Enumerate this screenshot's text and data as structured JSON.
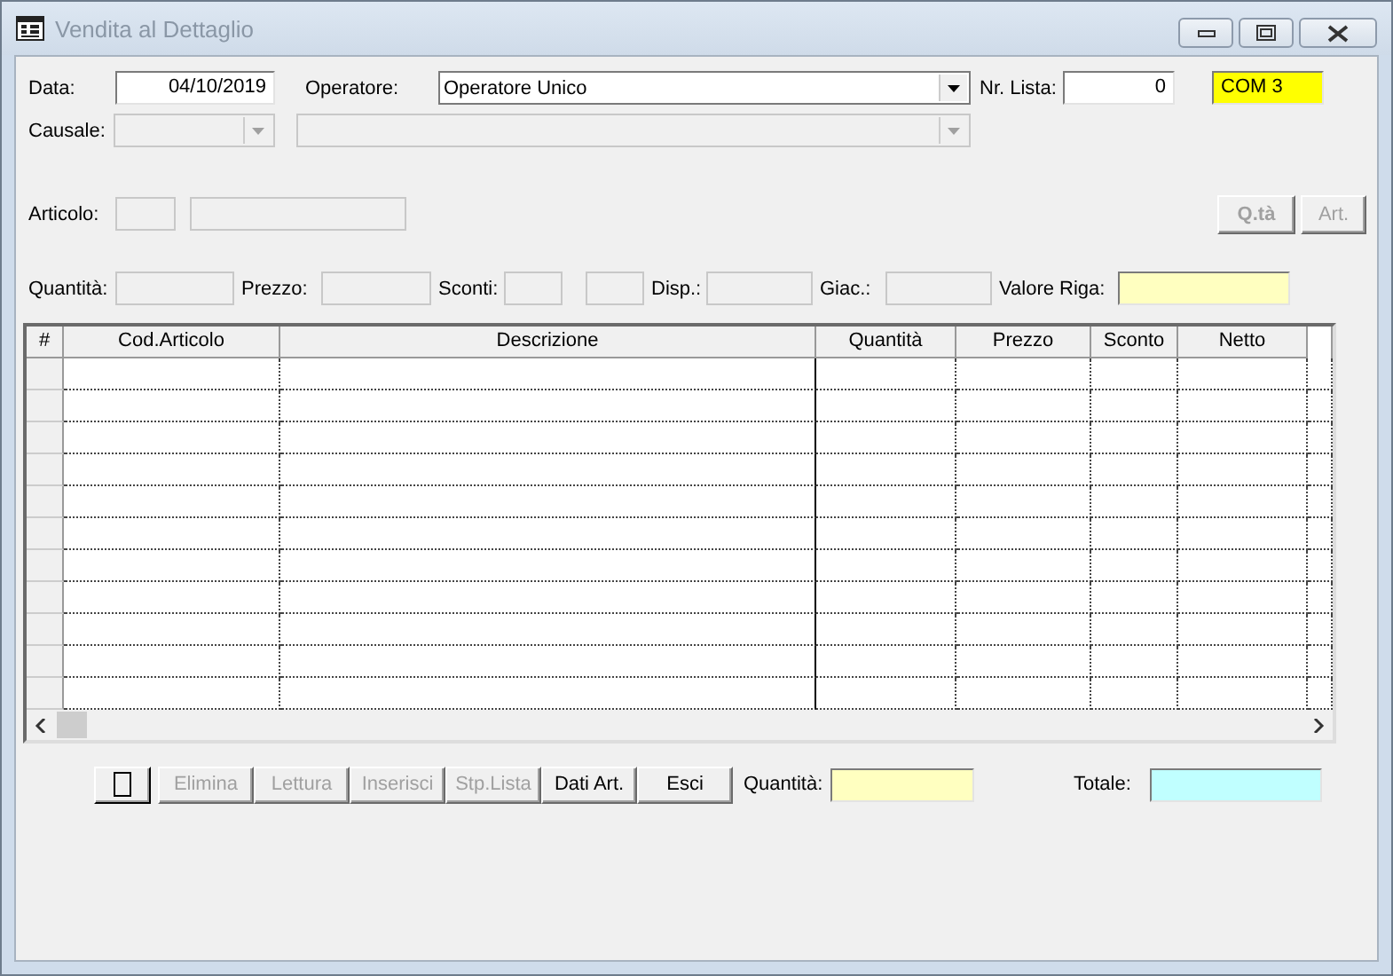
{
  "window": {
    "title": "Vendita al Dettaglio",
    "active": false
  },
  "data": {
    "label": "Data:",
    "value": "04/10/2019"
  },
  "operatore": {
    "label": "Operatore:",
    "value": "Operatore Unico"
  },
  "nr_lista": {
    "label": "Nr. Lista:",
    "value": "0"
  },
  "postazione": {
    "value": "COM 3"
  },
  "causale": {
    "label": "Causale:",
    "disabled": true
  },
  "articolo": {
    "label": "Articolo:"
  },
  "top_buttons": [
    {
      "label": "Q.tà",
      "disabled": true,
      "bold": true
    },
    {
      "label": "Art.",
      "disabled": true,
      "bold": false
    }
  ],
  "line_fields": [
    {
      "label": "Quantità:"
    },
    {
      "label": "Prezzo:"
    },
    {
      "label": "Sconti:"
    },
    {
      "label": "Disp.:"
    },
    {
      "label": "Giac.:"
    },
    {
      "label": "Valore Riga:"
    }
  ],
  "table": {
    "columns": [
      "#",
      "Cod.Articolo",
      "Descrizione",
      "Quantità",
      "Prezzo",
      "Sconto",
      "Netto"
    ]
  },
  "buttons": [
    {
      "kind": "icon",
      "disabled": false
    },
    {
      "kind": "text",
      "label": "Elimina",
      "disabled": true
    },
    {
      "kind": "text",
      "label": "Lettura",
      "disabled": true
    },
    {
      "kind": "text",
      "label": "Inserisci",
      "disabled": true
    },
    {
      "kind": "text",
      "label": "Stp.Lista",
      "disabled": true
    },
    {
      "kind": "text",
      "label": "Dati Art.",
      "disabled": false
    },
    {
      "kind": "text",
      "label": "Esci",
      "disabled": false
    }
  ],
  "totals": [
    {
      "label": "Quantità:"
    },
    {
      "label": "Totale:"
    }
  ]
}
